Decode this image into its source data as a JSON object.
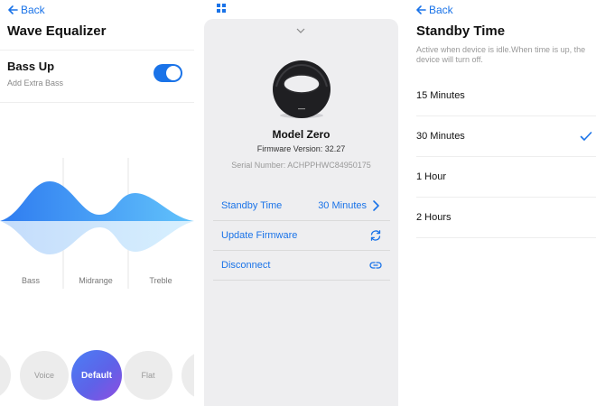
{
  "equalizer": {
    "back_label": "Back",
    "title": "Wave Equalizer",
    "bass_up": {
      "title": "Bass Up",
      "subtitle": "Add Extra Bass",
      "enabled": true
    },
    "bands": [
      "Bass",
      "Midrange",
      "Treble"
    ],
    "presets": [
      "Voice",
      "Default",
      "Flat"
    ],
    "active_preset": "Default",
    "colors": {
      "accent": "#1a73e8",
      "wave_top": "#3e8ef7",
      "wave_bottom": "#cfe3fb"
    }
  },
  "device": {
    "icon": "grid-icon",
    "model": "Model Zero",
    "firmware": "Firmware Version: 32.27",
    "serial": "Serial Number: ACHPPHWC84950175",
    "rows": [
      {
        "label": "Standby Time",
        "value": "30 Minutes",
        "icon": "chevron-right-icon"
      },
      {
        "label": "Update Firmware",
        "value": "",
        "icon": "refresh-icon"
      },
      {
        "label": "Disconnect",
        "value": "",
        "icon": "link-icon"
      }
    ]
  },
  "standby": {
    "back_label": "Back",
    "title": "Standby Time",
    "description": "Active when device is idle.When time is up, the device will turn off.",
    "options": [
      "15 Minutes",
      "30 Minutes",
      "1 Hour",
      "2 Hours"
    ],
    "selected": "30 Minutes"
  }
}
